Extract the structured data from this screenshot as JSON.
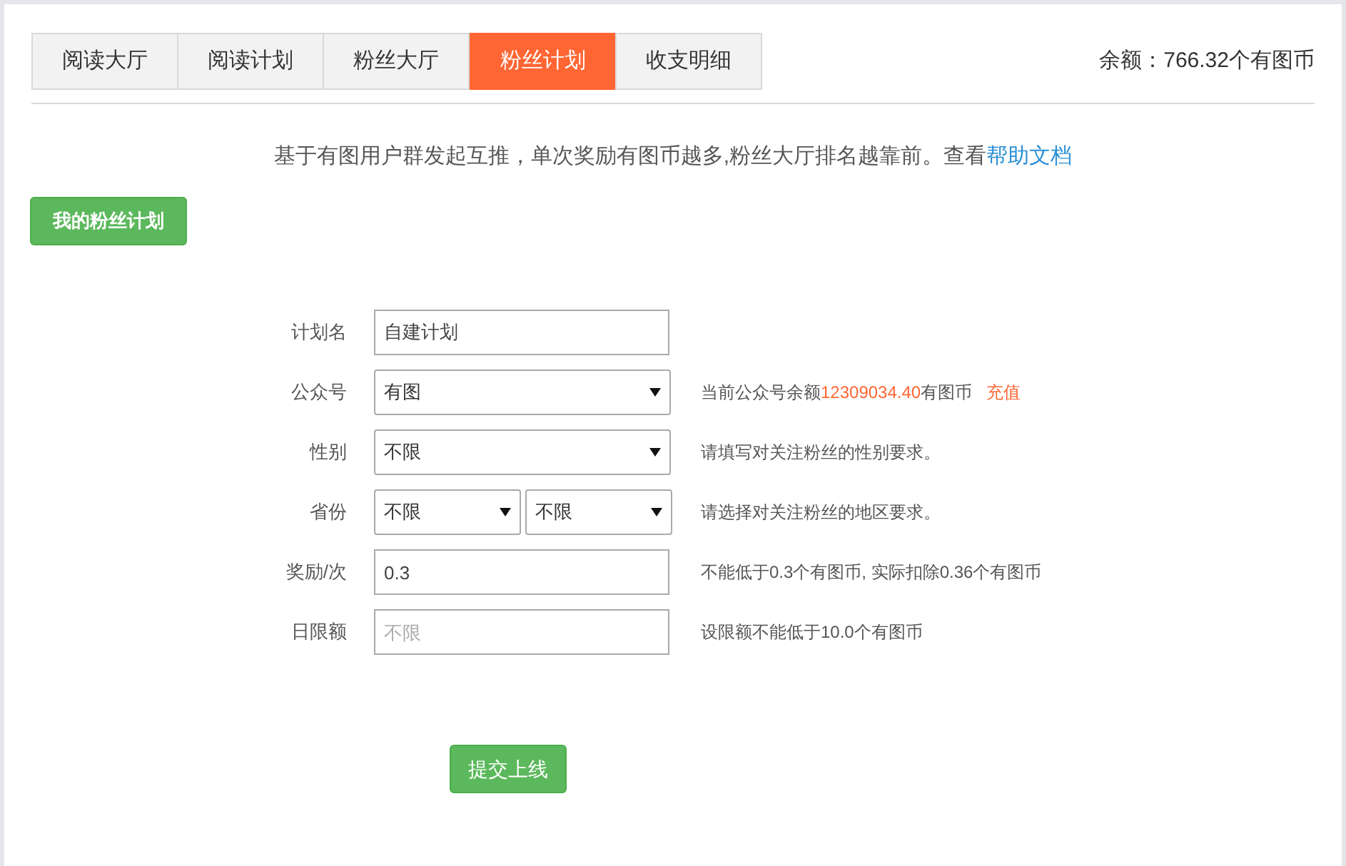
{
  "tabs": [
    {
      "label": "阅读大厅",
      "selected": false
    },
    {
      "label": "阅读计划",
      "selected": false
    },
    {
      "label": "粉丝大厅",
      "selected": false
    },
    {
      "label": "粉丝计划",
      "selected": true
    },
    {
      "label": "收支明细",
      "selected": false
    }
  ],
  "balance": "余额：766.32个有图币",
  "intro": {
    "text": "基于有图用户群发起互推，单次奖励有图币越多,粉丝大厅排名越靠前。查看",
    "link": "帮助文档"
  },
  "my_plans_button": "我的粉丝计划",
  "form": [
    {
      "kind": "text",
      "label": "计划名",
      "value": "自建计划"
    },
    {
      "kind": "select",
      "label": "公众号",
      "value": "有图",
      "hint": [
        {
          "kind": "text",
          "text": "当前公众号余额"
        },
        {
          "kind": "amount",
          "text": "12309034.40"
        },
        {
          "kind": "text",
          "text": "有图币"
        }
      ],
      "link": "充值"
    },
    {
      "kind": "select",
      "label": "性别",
      "value": "不限",
      "hint": [
        {
          "kind": "text",
          "text": "请填写对关注粉丝的性别要求。"
        }
      ]
    },
    {
      "kind": "select_pair",
      "label": "省份",
      "values": [
        "不限",
        "不限"
      ],
      "hint": [
        {
          "kind": "text",
          "text": "请选择对关注粉丝的地区要求。"
        }
      ]
    },
    {
      "kind": "text",
      "label": "奖励/次",
      "value": "0.3",
      "hint": [
        {
          "kind": "text",
          "text": "不能低于0.3个有图币, 实际扣除0.36个有图币"
        }
      ]
    },
    {
      "kind": "text",
      "label": "日限额",
      "placeholder": "不限",
      "hint": [
        {
          "kind": "text",
          "text": "设限额不能低于10.0个有图币"
        }
      ]
    }
  ],
  "submit_button": "提交上线"
}
